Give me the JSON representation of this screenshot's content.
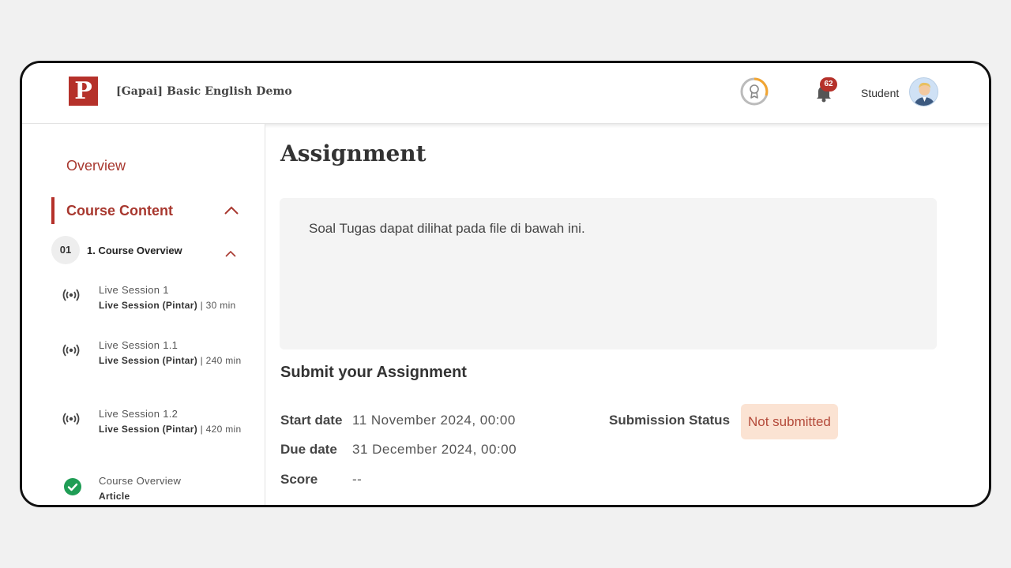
{
  "header": {
    "logo_letter": "P",
    "course_title": "[Gapai] Basic English Demo",
    "notification_count": "62",
    "user_name": "Student"
  },
  "sidebar": {
    "overview_label": "Overview",
    "course_content_label": "Course Content",
    "module": {
      "number": "01",
      "title": "1. Course Overview"
    },
    "lessons": [
      {
        "title": "Live Session 1",
        "type": "Live Session (Pintar)",
        "duration": " | 30 min",
        "icon": "broadcast-icon"
      },
      {
        "title": "Live Session 1.1",
        "type": "Live Session (Pintar)",
        "duration": " | 240 min",
        "icon": "broadcast-icon"
      },
      {
        "title": "Live Session 1.2",
        "type": "Live Session (Pintar)",
        "duration": " | 420 min",
        "icon": "broadcast-icon"
      },
      {
        "title": "Course Overview",
        "type": "Article",
        "duration": "",
        "icon": "check-circle-icon"
      }
    ]
  },
  "main": {
    "title": "Assignment",
    "description": "Soal Tugas dapat dilihat pada file di bawah ini.",
    "submit_title": "Submit your Assignment",
    "start_date_label": "Start date",
    "start_date_value": "11 November 2024, 00:00",
    "due_date_label": "Due date",
    "due_date_value": "31 December 2024, 00:00",
    "score_label": "Score",
    "score_value": "--",
    "status_label": "Submission Status",
    "status_value": "Not submitted"
  },
  "colors": {
    "brand": "#b5312a",
    "status_bg": "#fbe3d3",
    "success": "#1f9d55"
  }
}
